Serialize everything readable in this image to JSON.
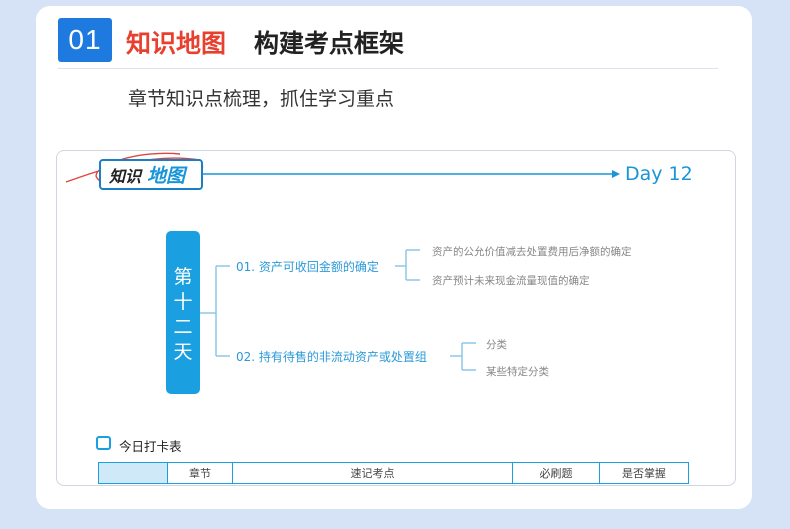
{
  "header": {
    "number": "01",
    "title_highlight": "知识地图",
    "title_rest": "构建考点框架",
    "subtitle": "章节知识点梳理，抓住学习重点"
  },
  "map": {
    "logo_part1": "知识",
    "logo_part2": "地图",
    "day_label": "Day 12",
    "root_chars": [
      "第",
      "十",
      "二",
      "天"
    ],
    "branches": [
      {
        "label": "01. 资产可收回金额的确定",
        "leaves": [
          "资产的公允价值减去处置费用后净额的确定",
          "资产预计未来现金流量现值的确定"
        ]
      },
      {
        "label": "02. 持有待售的非流动资产或处置组",
        "leaves": [
          "分类",
          "某些特定分类"
        ]
      }
    ]
  },
  "checkin": {
    "title": "今日打卡表",
    "columns": [
      "",
      "章节",
      "速记考点",
      "必刷题",
      "是否掌握"
    ]
  },
  "colors": {
    "brand_blue": "#1f7ae0",
    "accent_red": "#e8402e",
    "map_blue": "#1aa0e0"
  }
}
